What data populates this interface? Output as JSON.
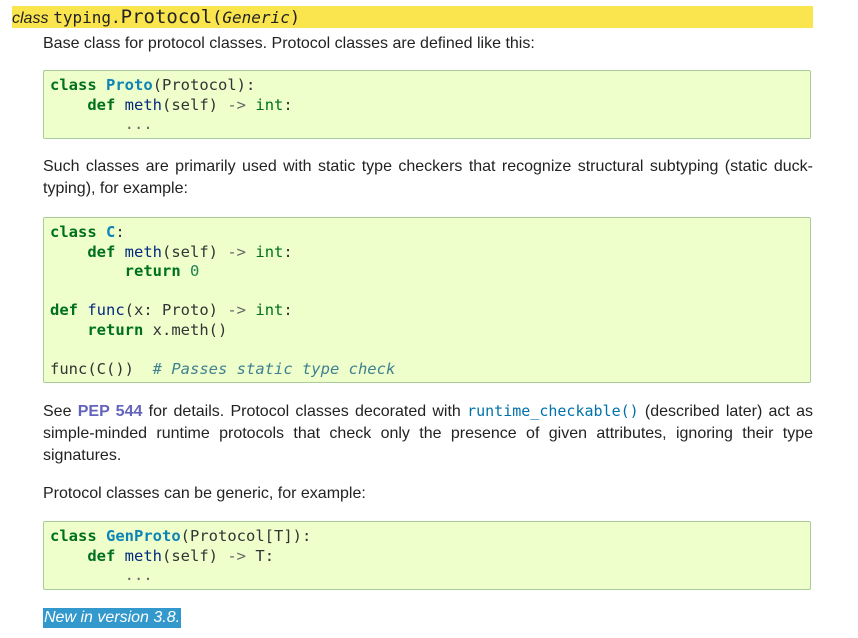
{
  "signature": {
    "keyword": "class",
    "module": "typing.",
    "name": "Protocol",
    "open_paren": "(",
    "param": "Generic",
    "close_paren": ")"
  },
  "intro": "Base class for protocol classes. Protocol classes are defined like this:",
  "code1": {
    "l1_kw": "class",
    "l1_name": "Proto",
    "l1_rest": "(Protocol):",
    "l2_kw": "def",
    "l2_name": "meth",
    "l2_args": "(self)",
    "l2_arrow": "->",
    "l2_type": "int",
    "l2_colon": ":",
    "l3": "..."
  },
  "para2": "Such classes are primarily used with static type checkers that recognize structural subtyping (static duck-typing), for example:",
  "code2": {
    "l1_kw": "class",
    "l1_name": "C",
    "l1_colon": ":",
    "l2_kw": "def",
    "l2_name": "meth",
    "l2_args": "(self)",
    "l2_arrow": "->",
    "l2_type": "int",
    "l2_colon": ":",
    "l3_kw": "return",
    "l3_num": "0",
    "l5_kw": "def",
    "l5_name": "func",
    "l5_args": "(x: Proto)",
    "l5_arrow": "->",
    "l5_type": "int",
    "l5_colon": ":",
    "l6_kw": "return",
    "l6_rest": "x.meth()",
    "l8_code": "func(C())",
    "l8_comment": "# Passes static type check"
  },
  "para3": {
    "t1": "See ",
    "pep": "PEP 544",
    "t2": " for details. Protocol classes decorated with ",
    "ref": "runtime_checkable()",
    "t3": " (described later) act as simple-minded runtime protocols that check only the presence of given attributes, ignoring their type signatures."
  },
  "para4": "Protocol classes can be generic, for example:",
  "code3": {
    "l1_kw": "class",
    "l1_name": "GenProto",
    "l1_rest": "(Protocol[T]):",
    "l2_kw": "def",
    "l2_name": "meth",
    "l2_args": "(self)",
    "l2_arrow": "->",
    "l2_type": "T:",
    "l3": "..."
  },
  "version_note": "New in version 3.8."
}
